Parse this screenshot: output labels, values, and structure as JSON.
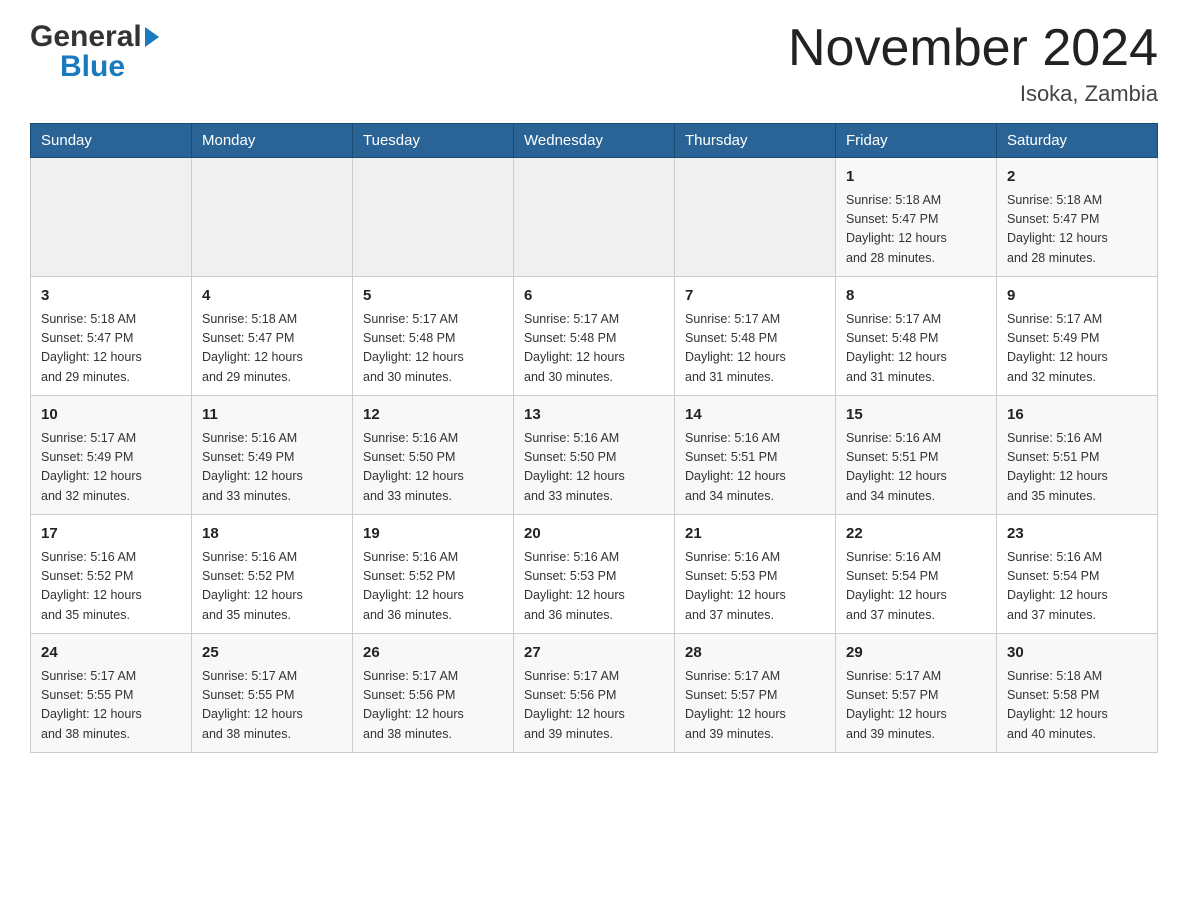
{
  "header": {
    "logo_general": "General",
    "logo_blue": "Blue",
    "title": "November 2024",
    "location": "Isoka, Zambia"
  },
  "weekdays": [
    "Sunday",
    "Monday",
    "Tuesday",
    "Wednesday",
    "Thursday",
    "Friday",
    "Saturday"
  ],
  "rows": [
    {
      "cells": [
        {
          "day": "",
          "info": ""
        },
        {
          "day": "",
          "info": ""
        },
        {
          "day": "",
          "info": ""
        },
        {
          "day": "",
          "info": ""
        },
        {
          "day": "",
          "info": ""
        },
        {
          "day": "1",
          "info": "Sunrise: 5:18 AM\nSunset: 5:47 PM\nDaylight: 12 hours\nand 28 minutes."
        },
        {
          "day": "2",
          "info": "Sunrise: 5:18 AM\nSunset: 5:47 PM\nDaylight: 12 hours\nand 28 minutes."
        }
      ]
    },
    {
      "cells": [
        {
          "day": "3",
          "info": "Sunrise: 5:18 AM\nSunset: 5:47 PM\nDaylight: 12 hours\nand 29 minutes."
        },
        {
          "day": "4",
          "info": "Sunrise: 5:18 AM\nSunset: 5:47 PM\nDaylight: 12 hours\nand 29 minutes."
        },
        {
          "day": "5",
          "info": "Sunrise: 5:17 AM\nSunset: 5:48 PM\nDaylight: 12 hours\nand 30 minutes."
        },
        {
          "day": "6",
          "info": "Sunrise: 5:17 AM\nSunset: 5:48 PM\nDaylight: 12 hours\nand 30 minutes."
        },
        {
          "day": "7",
          "info": "Sunrise: 5:17 AM\nSunset: 5:48 PM\nDaylight: 12 hours\nand 31 minutes."
        },
        {
          "day": "8",
          "info": "Sunrise: 5:17 AM\nSunset: 5:48 PM\nDaylight: 12 hours\nand 31 minutes."
        },
        {
          "day": "9",
          "info": "Sunrise: 5:17 AM\nSunset: 5:49 PM\nDaylight: 12 hours\nand 32 minutes."
        }
      ]
    },
    {
      "cells": [
        {
          "day": "10",
          "info": "Sunrise: 5:17 AM\nSunset: 5:49 PM\nDaylight: 12 hours\nand 32 minutes."
        },
        {
          "day": "11",
          "info": "Sunrise: 5:16 AM\nSunset: 5:49 PM\nDaylight: 12 hours\nand 33 minutes."
        },
        {
          "day": "12",
          "info": "Sunrise: 5:16 AM\nSunset: 5:50 PM\nDaylight: 12 hours\nand 33 minutes."
        },
        {
          "day": "13",
          "info": "Sunrise: 5:16 AM\nSunset: 5:50 PM\nDaylight: 12 hours\nand 33 minutes."
        },
        {
          "day": "14",
          "info": "Sunrise: 5:16 AM\nSunset: 5:51 PM\nDaylight: 12 hours\nand 34 minutes."
        },
        {
          "day": "15",
          "info": "Sunrise: 5:16 AM\nSunset: 5:51 PM\nDaylight: 12 hours\nand 34 minutes."
        },
        {
          "day": "16",
          "info": "Sunrise: 5:16 AM\nSunset: 5:51 PM\nDaylight: 12 hours\nand 35 minutes."
        }
      ]
    },
    {
      "cells": [
        {
          "day": "17",
          "info": "Sunrise: 5:16 AM\nSunset: 5:52 PM\nDaylight: 12 hours\nand 35 minutes."
        },
        {
          "day": "18",
          "info": "Sunrise: 5:16 AM\nSunset: 5:52 PM\nDaylight: 12 hours\nand 35 minutes."
        },
        {
          "day": "19",
          "info": "Sunrise: 5:16 AM\nSunset: 5:52 PM\nDaylight: 12 hours\nand 36 minutes."
        },
        {
          "day": "20",
          "info": "Sunrise: 5:16 AM\nSunset: 5:53 PM\nDaylight: 12 hours\nand 36 minutes."
        },
        {
          "day": "21",
          "info": "Sunrise: 5:16 AM\nSunset: 5:53 PM\nDaylight: 12 hours\nand 37 minutes."
        },
        {
          "day": "22",
          "info": "Sunrise: 5:16 AM\nSunset: 5:54 PM\nDaylight: 12 hours\nand 37 minutes."
        },
        {
          "day": "23",
          "info": "Sunrise: 5:16 AM\nSunset: 5:54 PM\nDaylight: 12 hours\nand 37 minutes."
        }
      ]
    },
    {
      "cells": [
        {
          "day": "24",
          "info": "Sunrise: 5:17 AM\nSunset: 5:55 PM\nDaylight: 12 hours\nand 38 minutes."
        },
        {
          "day": "25",
          "info": "Sunrise: 5:17 AM\nSunset: 5:55 PM\nDaylight: 12 hours\nand 38 minutes."
        },
        {
          "day": "26",
          "info": "Sunrise: 5:17 AM\nSunset: 5:56 PM\nDaylight: 12 hours\nand 38 minutes."
        },
        {
          "day": "27",
          "info": "Sunrise: 5:17 AM\nSunset: 5:56 PM\nDaylight: 12 hours\nand 39 minutes."
        },
        {
          "day": "28",
          "info": "Sunrise: 5:17 AM\nSunset: 5:57 PM\nDaylight: 12 hours\nand 39 minutes."
        },
        {
          "day": "29",
          "info": "Sunrise: 5:17 AM\nSunset: 5:57 PM\nDaylight: 12 hours\nand 39 minutes."
        },
        {
          "day": "30",
          "info": "Sunrise: 5:18 AM\nSunset: 5:58 PM\nDaylight: 12 hours\nand 40 minutes."
        }
      ]
    }
  ]
}
